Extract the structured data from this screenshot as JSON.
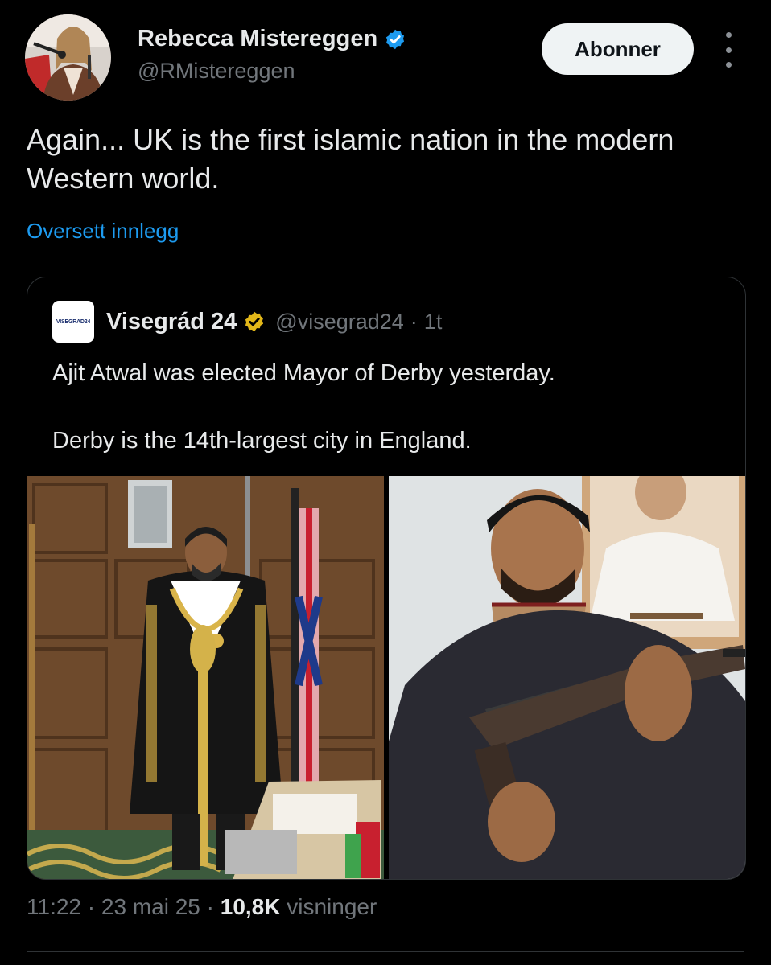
{
  "author": {
    "name": "Rebecca Mistereggen",
    "handle": "@RMistereggen",
    "verified_color": "#1d9bf0"
  },
  "follow_label": "Abonner",
  "more_icon": "more-vertical-icon",
  "tweet": {
    "text": "Again... UK is the first islamic nation in the modern Western world.",
    "translate_label": "Oversett innlegg"
  },
  "quote": {
    "avatar_text": "VISEGRAD24",
    "name": "Visegrád 24",
    "badge_color": "#e2b719",
    "handle": "@visegrad24",
    "separator": "·",
    "time": "1t",
    "line1": "Ajit Atwal was elected Mayor of Derby yesterday.",
    "line2": "Derby is the 14th-largest city in England."
  },
  "meta": {
    "time": "11:22",
    "sep1": "·",
    "date": "23 mai 25",
    "sep2": "·",
    "views_count": "10,8K",
    "views_label": "visninger"
  },
  "colors": {
    "background": "#000000",
    "text": "#e7e9ea",
    "secondary": "#71767b",
    "link": "#1d9bf0",
    "border": "#2f3336"
  }
}
